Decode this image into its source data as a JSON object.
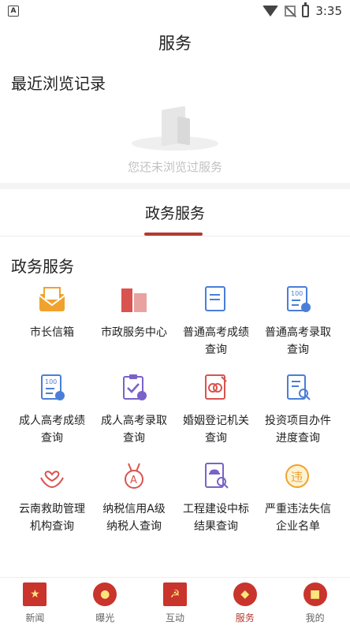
{
  "status": {
    "time": "3:35"
  },
  "header": {
    "title": "服务"
  },
  "recent": {
    "title": "最近浏览记录",
    "empty_text": "您还未浏览过服务"
  },
  "tabs": {
    "active": "政务服务"
  },
  "section": {
    "title": "政务服务",
    "items": [
      {
        "label": "市长信箱",
        "icon": "mail-icon"
      },
      {
        "label": "市政服务中心",
        "icon": "building-icon"
      },
      {
        "label": "普通高考成绩查询",
        "icon": "score-doc-icon"
      },
      {
        "label": "普通高考录取查询",
        "icon": "admission-doc-icon"
      },
      {
        "label": "成人高考成绩查询",
        "icon": "score-doc-icon"
      },
      {
        "label": "成人高考录取查询",
        "icon": "clipboard-check-icon"
      },
      {
        "label": "婚姻登记机关查询",
        "icon": "marriage-icon"
      },
      {
        "label": "投资项目办件进度查询",
        "icon": "doc-search-icon"
      },
      {
        "label": "云南救助管理机构查询",
        "icon": "heart-hands-icon"
      },
      {
        "label": "纳税信用A级纳税人查询",
        "icon": "medal-a-icon"
      },
      {
        "label": "工程建设中标结果查询",
        "icon": "construction-search-icon"
      },
      {
        "label": "严重违法失信企业名单",
        "icon": "violation-icon"
      }
    ]
  },
  "tabbar": {
    "items": [
      {
        "label": "新闻",
        "active": false
      },
      {
        "label": "曝光",
        "active": false
      },
      {
        "label": "互动",
        "active": false
      },
      {
        "label": "服务",
        "active": true
      },
      {
        "label": "我的",
        "active": false
      }
    ]
  },
  "colors": {
    "accent": "#b33b2f",
    "icon_blue": "#4a7ed8",
    "icon_purple": "#7a62c9",
    "icon_red": "#d9534f",
    "icon_orange": "#f0a22e"
  }
}
